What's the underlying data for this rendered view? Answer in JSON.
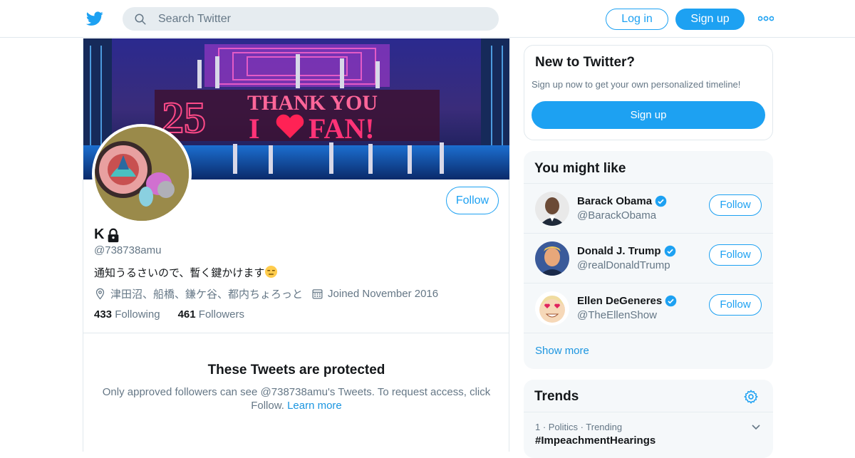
{
  "header": {
    "logo": "twitter-bird-icon",
    "search": {
      "placeholder": "Search Twitter",
      "icon": "search-icon"
    },
    "login_label": "Log in",
    "signup_label": "Sign up",
    "more_icon": "more-dots-icon"
  },
  "profile": {
    "follow_label": "Follow",
    "name": "K",
    "protected_icon": "lock-icon",
    "handle": "@738738amu",
    "bio": "通知うるさいので、暫く鍵かけます",
    "bio_emoji": "expressionless-face-emoji",
    "location": "津田沼、船橋、鎌ケ谷、都内ちょろっと",
    "joined": "Joined November 2016",
    "following_count": "433",
    "following_label": "Following",
    "followers_count": "461",
    "followers_label": "Followers",
    "banner_text": "25 THANK YOU I ♥ FAN!"
  },
  "protected": {
    "title": "These Tweets are protected",
    "message": "Only approved followers can see @738738amu's Tweets. To request access, click Follow.",
    "learn_more": "Learn more"
  },
  "new_to_twitter": {
    "title": "New to Twitter?",
    "subtitle": "Sign up now to get your own personalized timeline!",
    "signup_label": "Sign up"
  },
  "you_might_like": {
    "title": "You might like",
    "accounts": [
      {
        "name": "Barack Obama",
        "handle": "@BarackObama",
        "verified": true,
        "follow_label": "Follow"
      },
      {
        "name": "Donald J. Trump",
        "handle": "@realDonaldTrump",
        "verified": true,
        "follow_label": "Follow"
      },
      {
        "name": "Ellen DeGeneres",
        "handle": "@TheEllenShow",
        "verified": true,
        "follow_label": "Follow"
      }
    ],
    "show_more": "Show more"
  },
  "trends": {
    "title": "Trends",
    "settings_icon": "gear-icon",
    "items": [
      {
        "context": "1 · Politics · Trending",
        "name": "#ImpeachmentHearings"
      }
    ]
  },
  "colors": {
    "brand": "#1da1f2",
    "link": "#1b95e0",
    "muted_text": "#657786",
    "panel_bg": "#f5f8fa",
    "border": "#e1e8ed"
  }
}
